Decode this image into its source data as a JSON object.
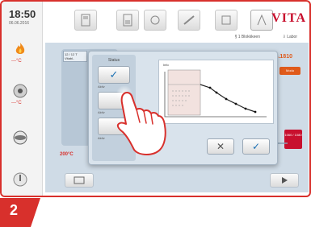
{
  "status_bar": {
    "time": "18:50",
    "date": "06.06.2016"
  },
  "sidebar": {
    "items": [
      {
        "icon": "flame-icon",
        "value": "---°C"
      },
      {
        "icon": "vacuum-pump-icon",
        "value": "---°C"
      },
      {
        "icon": "disc-icon",
        "value": ""
      },
      {
        "icon": "standby-icon",
        "value": ""
      }
    ]
  },
  "header": {
    "brand": "VITA",
    "info_left": "§ 1 Blokkkeen",
    "info_right": "⇩ Labor"
  },
  "background": {
    "program_label": "12 / 12 T Vitabl..",
    "temp_label": "200°C",
    "right_value": "3.1810",
    "right_chip": "Modu",
    "right_red": "1060 / 1080"
  },
  "dialog": {
    "status_title": "Status",
    "status_buttons": [
      {
        "label": "Aktiv",
        "glyph": "✓"
      },
      {
        "label": "Aktiv",
        "glyph": ""
      },
      {
        "label": "Aktiv",
        "glyph": ""
      }
    ],
    "graph_title": "Info",
    "cancel_glyph": "✕",
    "confirm_glyph": "✓"
  },
  "step_number": "2",
  "colors": {
    "accent": "#d8302c",
    "brand": "#c8102e",
    "dialog_bg": "#d9e3ec"
  }
}
